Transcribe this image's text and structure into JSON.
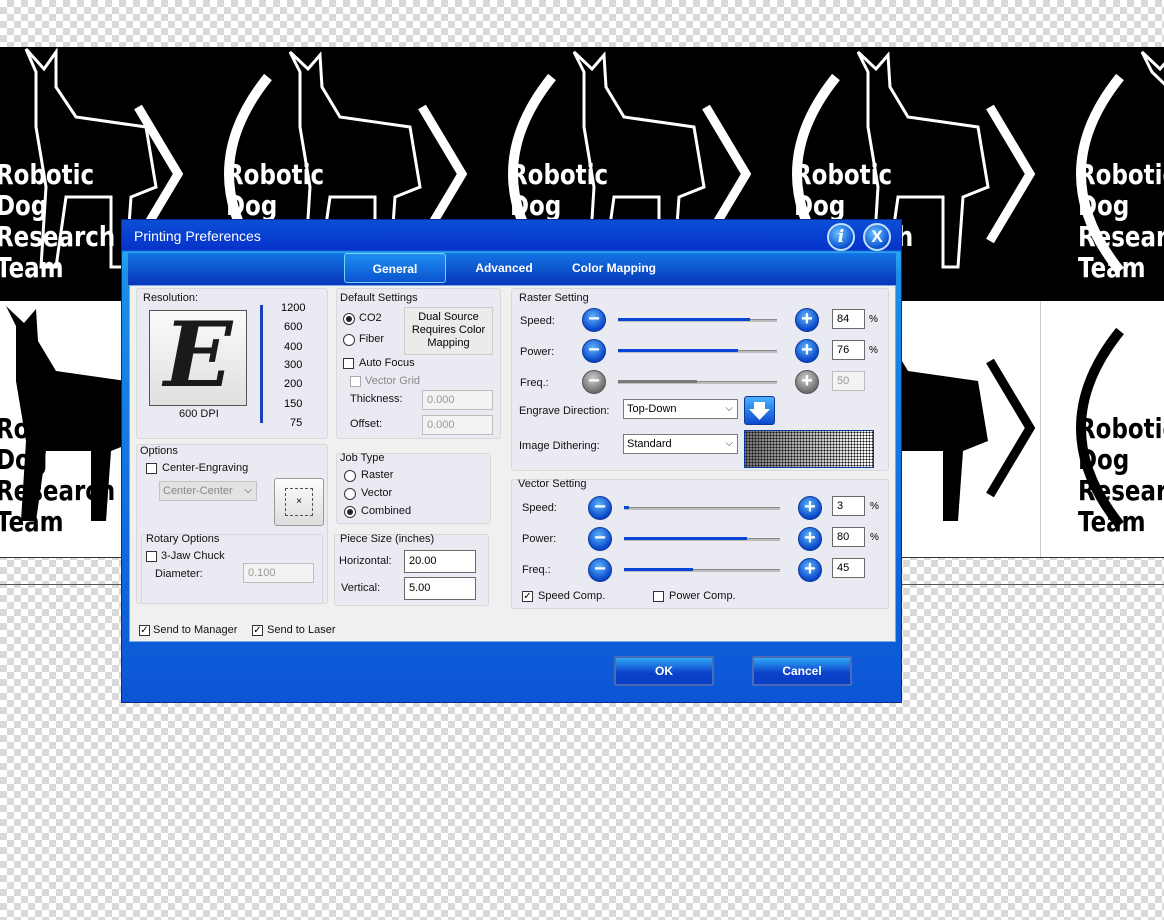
{
  "canvas": {
    "tile_lines": [
      "Robotic",
      "Dog",
      "Research",
      "Team"
    ]
  },
  "dialog": {
    "title": "Printing Preferences",
    "info_icon": "i",
    "close_icon": "X",
    "tabs": [
      "General",
      "Advanced",
      "Color Mapping"
    ],
    "active_tab": "General"
  },
  "resolution": {
    "label": "Resolution:",
    "preview_letter": "E",
    "current": "600 DPI",
    "scale": [
      "1200",
      "600",
      "400",
      "300",
      "200",
      "150",
      "75"
    ]
  },
  "default_settings": {
    "label": "Default Settings",
    "co2": "CO2",
    "fiber": "Fiber",
    "dual_source": "Dual Source Requires Color Mapping",
    "auto_focus": "Auto Focus",
    "vector_grid": "Vector Grid",
    "thickness_label": "Thickness:",
    "thickness_value": "0.000",
    "offset_label": "Offset:",
    "offset_value": "0.000"
  },
  "options": {
    "label": "Options",
    "center_engraving": "Center-Engraving",
    "position_select": "Center-Center",
    "position_marker": "×"
  },
  "job_type": {
    "label": "Job Type",
    "raster": "Raster",
    "vector": "Vector",
    "combined": "Combined",
    "selected": "Combined"
  },
  "rotary": {
    "label": "Rotary Options",
    "jaw_chuck": "3-Jaw Chuck",
    "diameter_label": "Diameter:",
    "diameter_value": "0.100"
  },
  "piece_size": {
    "label": "Piece Size (inches)",
    "horizontal_label": "Horizontal:",
    "horizontal_value": "20.00",
    "vertical_label": "Vertical:",
    "vertical_value": "5.00"
  },
  "raster": {
    "label": "Raster Setting",
    "speed_label": "Speed:",
    "speed_value": "84",
    "power_label": "Power:",
    "power_value": "76",
    "freq_label": "Freq.:",
    "freq_value": "50",
    "percent": "%",
    "engrave_direction_label": "Engrave Direction:",
    "engrave_direction": "Top-Down",
    "image_dithering_label": "Image Dithering:",
    "image_dithering": "Standard"
  },
  "vector": {
    "label": "Vector Setting",
    "speed_label": "Speed:",
    "speed_value": "3",
    "power_label": "Power:",
    "power_value": "80",
    "freq_label": "Freq.:",
    "freq_value": "45",
    "percent": "%",
    "speed_comp": "Speed Comp.",
    "power_comp": "Power Comp."
  },
  "footer": {
    "send_to_manager": "Send to Manager",
    "send_to_laser": "Send to Laser",
    "ok": "OK",
    "cancel": "Cancel"
  },
  "controls": {
    "minus": "−",
    "plus": "+",
    "dropdown_arrow": "⌵",
    "check": "✓",
    "down_arrow_icon": "down-arrow-icon"
  }
}
